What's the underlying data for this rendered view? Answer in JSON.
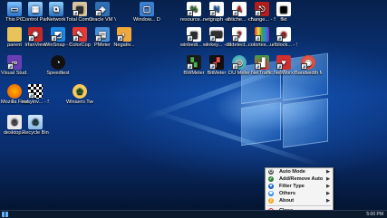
{
  "colors": {
    "accent": "#0b3a8a",
    "taskbar": "#0c1a2d",
    "menu_bg": "#f4f4f4"
  },
  "desktop_icons": [
    {
      "label": "This PC",
      "icon": "computer-icon"
    },
    {
      "label": "Control Panel",
      "icon": "control-panel-icon"
    },
    {
      "label": "Network",
      "icon": "network-icon"
    },
    {
      "label": "Total Comma...",
      "icon": "floppy-disk-icon"
    },
    {
      "label": "Oracle VM VirtualBox",
      "icon": "virtualbox-icon"
    },
    {
      "label": "Window... DPI Fix",
      "icon": "window-icon"
    },
    {
      "label": "parent",
      "icon": "folder-icon"
    },
    {
      "label": "IrfanView",
      "icon": "irfanview-icon"
    },
    {
      "label": "WinSnap - Shortcut",
      "icon": "winsnap-icon"
    },
    {
      "label": "ColorCop",
      "icon": "eyedropper-icon"
    },
    {
      "label": "PMeter",
      "icon": "pmeter-icon"
    },
    {
      "label": "Negativ...",
      "icon": "negative-icon"
    },
    {
      "label": "Visual Stud...",
      "icon": "visual-studio-icon"
    },
    {
      "label": "Speedtest",
      "icon": "speedometer-icon"
    },
    {
      "label": "Mozilla Firefox",
      "icon": "firefox-icon"
    },
    {
      "label": "easyinv... - Shortcut",
      "icon": "checkerboard-icon"
    },
    {
      "label": "Winaero Tweaker",
      "icon": "winaero-icon"
    },
    {
      "label": "desktop...",
      "icon": "ini-file-icon"
    },
    {
      "label": "Recycle Bin",
      "icon": "recycle-bin-icon"
    },
    {
      "label": "resource... - Shortcut",
      "icon": "percent-icon"
    },
    {
      "label": "netgraph - Shortcut",
      "icon": "netgraph-icon"
    },
    {
      "label": "antiche... - Shortcut",
      "icon": "letter-a-icon"
    },
    {
      "label": "change... - Shortcut",
      "icon": "change-icon"
    },
    {
      "label": "flkt",
      "icon": "grid-icon"
    },
    {
      "label": "winbedi... - Shortcut",
      "icon": "winbedit-icon"
    },
    {
      "label": "winkey... - Shortcut",
      "icon": "winkey-icon"
    },
    {
      "label": "oddetect... - Shortcut",
      "icon": "question-icon"
    },
    {
      "label": "colortes... - Shortcut",
      "icon": "colortest-icon"
    },
    {
      "label": "urlblock... - Shortcut",
      "icon": "urlblock-icon"
    },
    {
      "label": "BWMeter",
      "icon": "bwmeter-icon"
    },
    {
      "label": "BitMeter",
      "icon": "bitmeter-icon"
    },
    {
      "label": "DU Meter",
      "icon": "du-meter-icon"
    },
    {
      "label": "NetTraffic",
      "icon": "nettraffic-icon"
    },
    {
      "label": "NetWorx",
      "icon": "networx-icon"
    },
    {
      "label": "Bandwidth Monitor",
      "icon": "bandwidth-monitor-icon"
    }
  ],
  "context_menu": {
    "items": [
      {
        "label": "Auto Mode",
        "icon": "power-icon",
        "has_submenu": true
      },
      {
        "label": "Add/Remove Auto",
        "icon": "check-icon",
        "has_submenu": true
      },
      {
        "label": "Filter Type",
        "icon": "filter-icon",
        "has_submenu": true
      },
      {
        "label": "Others",
        "icon": "gear-icon",
        "has_submenu": true
      },
      {
        "label": "About",
        "icon": "info-icon",
        "has_submenu": true
      },
      {
        "label": "Close",
        "icon": "close-icon",
        "has_submenu": false
      }
    ],
    "submenu_arrow": "▶"
  },
  "taskbar": {
    "clock": "5:00 PM"
  }
}
